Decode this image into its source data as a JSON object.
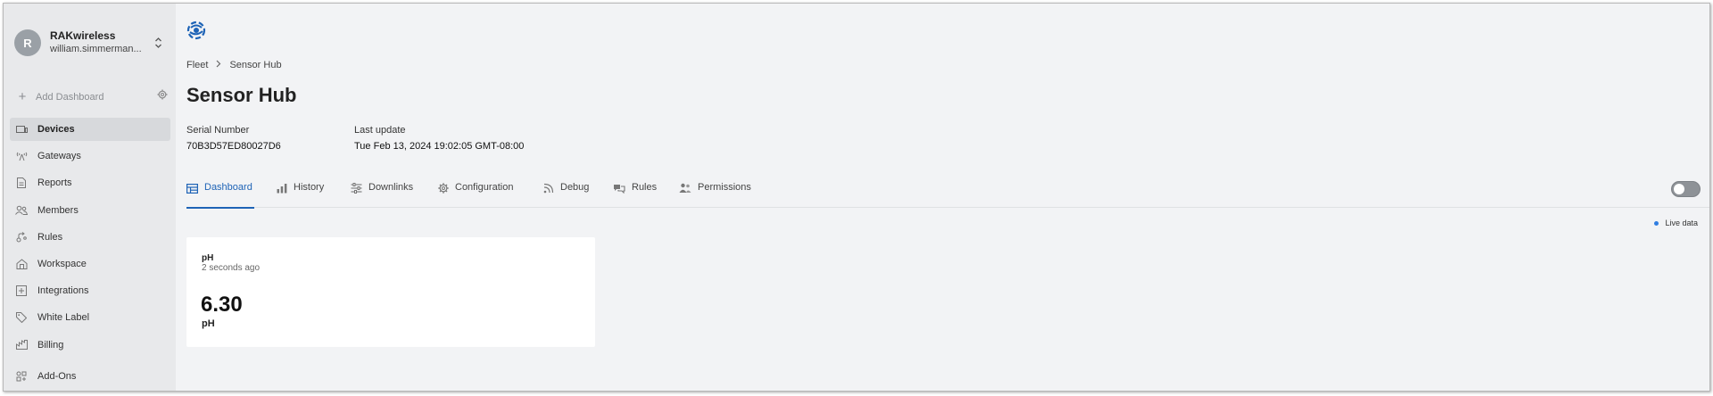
{
  "sidebar": {
    "org": {
      "initial": "R",
      "name": "RAKwireless",
      "user": "william.simmerman..."
    },
    "add_dashboard": "Add Dashboard",
    "items": [
      {
        "label": "Devices",
        "icon": "devices-icon",
        "active": true
      },
      {
        "label": "Gateways",
        "icon": "gateway-icon",
        "active": false
      },
      {
        "label": "Reports",
        "icon": "report-icon",
        "active": false
      },
      {
        "label": "Members",
        "icon": "members-icon",
        "active": false
      },
      {
        "label": "Rules",
        "icon": "rules-icon",
        "active": false
      },
      {
        "label": "Workspace",
        "icon": "workspace-icon",
        "active": false
      },
      {
        "label": "Integrations",
        "icon": "integrations-icon",
        "active": false
      },
      {
        "label": "White Label",
        "icon": "tag-icon",
        "active": false
      },
      {
        "label": "Billing",
        "icon": "billing-icon",
        "active": false
      },
      {
        "label": "Add-Ons",
        "icon": "addons-icon",
        "active": false
      }
    ]
  },
  "breadcrumb": {
    "parent": "Fleet",
    "current": "Sensor Hub"
  },
  "page": {
    "title": "Sensor Hub",
    "serial_label": "Serial Number",
    "serial_value": "70B3D57ED80027D6",
    "update_label": "Last update",
    "update_value": "Tue Feb 13, 2024 19:02:05 GMT-08:00"
  },
  "tabs": [
    {
      "label": "Dashboard",
      "icon": "dashboard-icon",
      "active": true
    },
    {
      "label": "History",
      "icon": "bar-chart-icon",
      "active": false
    },
    {
      "label": "Downlinks",
      "icon": "sliders-icon",
      "active": false
    },
    {
      "label": "Configuration",
      "icon": "gear-icon",
      "active": false
    },
    {
      "label": "Debug",
      "icon": "rss-icon",
      "active": false
    },
    {
      "label": "Rules",
      "icon": "rules-icon",
      "active": false
    },
    {
      "label": "Permissions",
      "icon": "people-icon",
      "active": false
    }
  ],
  "live_data": {
    "label": "Live data",
    "on": false,
    "dot_color": "#2f7de1"
  },
  "card": {
    "name": "pH",
    "ago": "2 seconds ago",
    "value": "6.30",
    "unit": "pH"
  },
  "colors": {
    "accent": "#1e63b6",
    "sidebar_bg": "#e8e9eb",
    "main_bg": "#f2f3f5"
  }
}
